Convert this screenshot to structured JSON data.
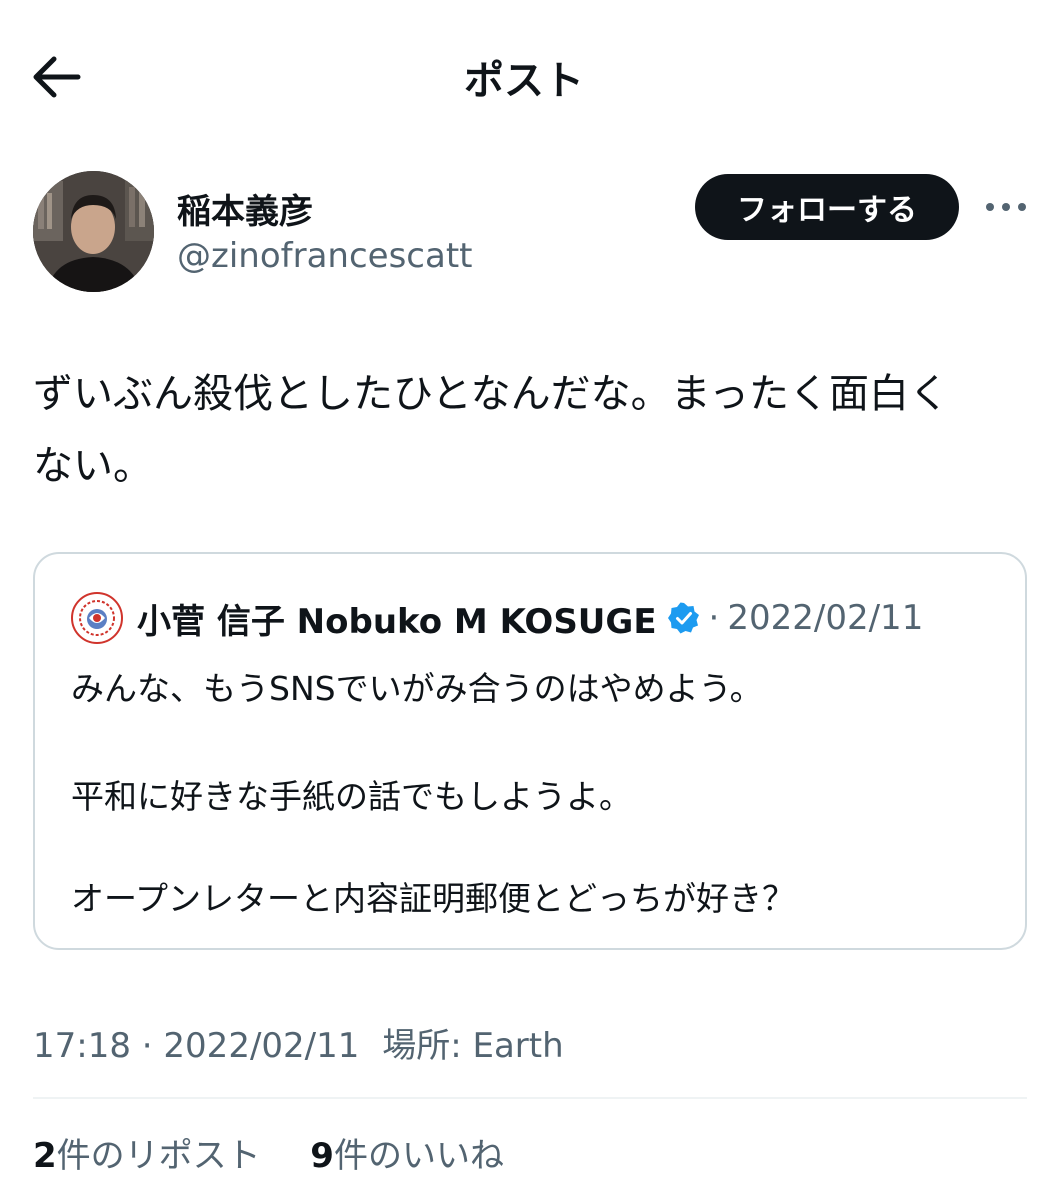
{
  "header": {
    "title": "ポスト",
    "back_icon": "arrow-left-icon"
  },
  "post": {
    "author_name": "稲本義彦",
    "author_handle": "@zinofrancescatt",
    "follow_label": "フォローする",
    "more_icon": "more-horizontal-icon",
    "text": "ずいぶん殺伐としたひとなんだな。まったく面白く\nない。",
    "time": "17:18",
    "date": "2022/02/11",
    "place_label": "場所:",
    "place": "Earth"
  },
  "quote": {
    "author_name": "小菅 信子 Nobuko M KOSUGE",
    "verified_icon": "verified-badge-icon",
    "separator": "·",
    "date": "2022/02/11",
    "lines": [
      "みんな、もうSNSでいがみ合うのはやめよう。",
      "平和に好きな手紙の話でもしようよ。",
      "オープンレターと内容証明郵便とどっちが好き？"
    ]
  },
  "stats": {
    "reposts_count": "2",
    "reposts_label": "件のリポスト",
    "likes_count": "9",
    "likes_label": "件のいいね"
  },
  "colors": {
    "text": "#0f1419",
    "secondary": "#536471",
    "follow_bg": "#0f1419",
    "verified": "#1d9bf0",
    "border": "#cfd9de"
  }
}
